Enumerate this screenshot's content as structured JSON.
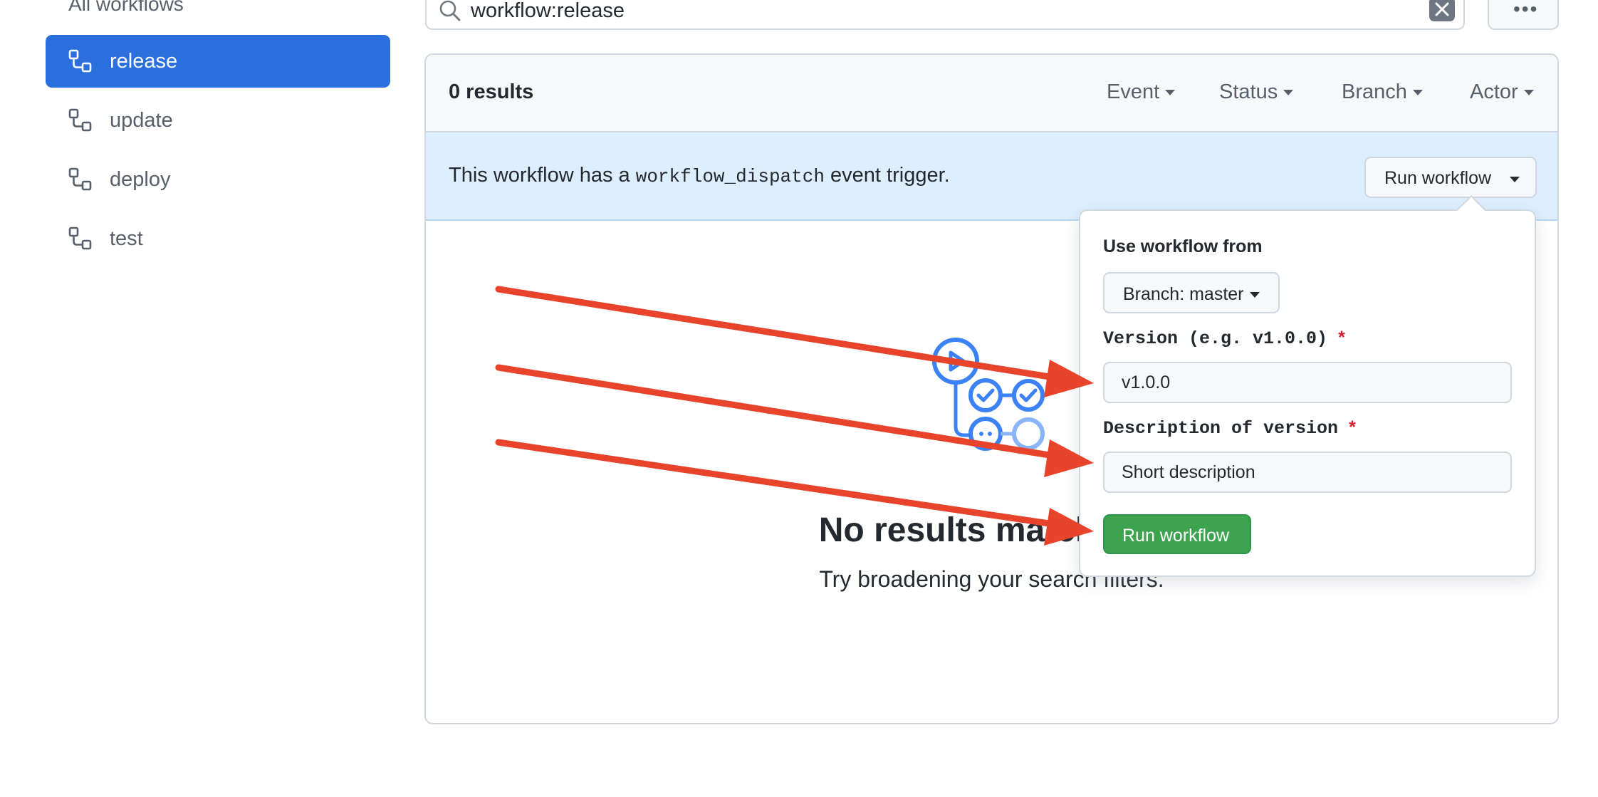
{
  "sidebar": {
    "all_workflows": "All workflows",
    "items": [
      {
        "label": "release",
        "active": true
      },
      {
        "label": "update",
        "active": false
      },
      {
        "label": "deploy",
        "active": false
      },
      {
        "label": "test",
        "active": false
      }
    ]
  },
  "search": {
    "query": "workflow:release"
  },
  "panel": {
    "results": "0 results",
    "filters": [
      "Event",
      "Status",
      "Branch",
      "Actor"
    ],
    "dispatch": {
      "prefix": "This workflow has a",
      "code": "workflow_dispatch",
      "suffix": "event trigger.",
      "run_button": "Run workflow"
    },
    "empty": {
      "title": "No results matched y",
      "subtitle": "Try broadening your search filters."
    }
  },
  "dropdown": {
    "heading": "Use workflow from",
    "branch_button": "Branch: master",
    "version_label": "Version (e.g. v1.0.0)",
    "version_value": "v1.0.0",
    "description_label": "Description of version",
    "description_value": "Short description",
    "required_mark": "*",
    "submit": "Run workflow"
  },
  "colors": {
    "accent": "#2a6fdb",
    "annotation_arrow": "#e8432b",
    "run_green": "#3da34f",
    "required": "#cf222e"
  }
}
